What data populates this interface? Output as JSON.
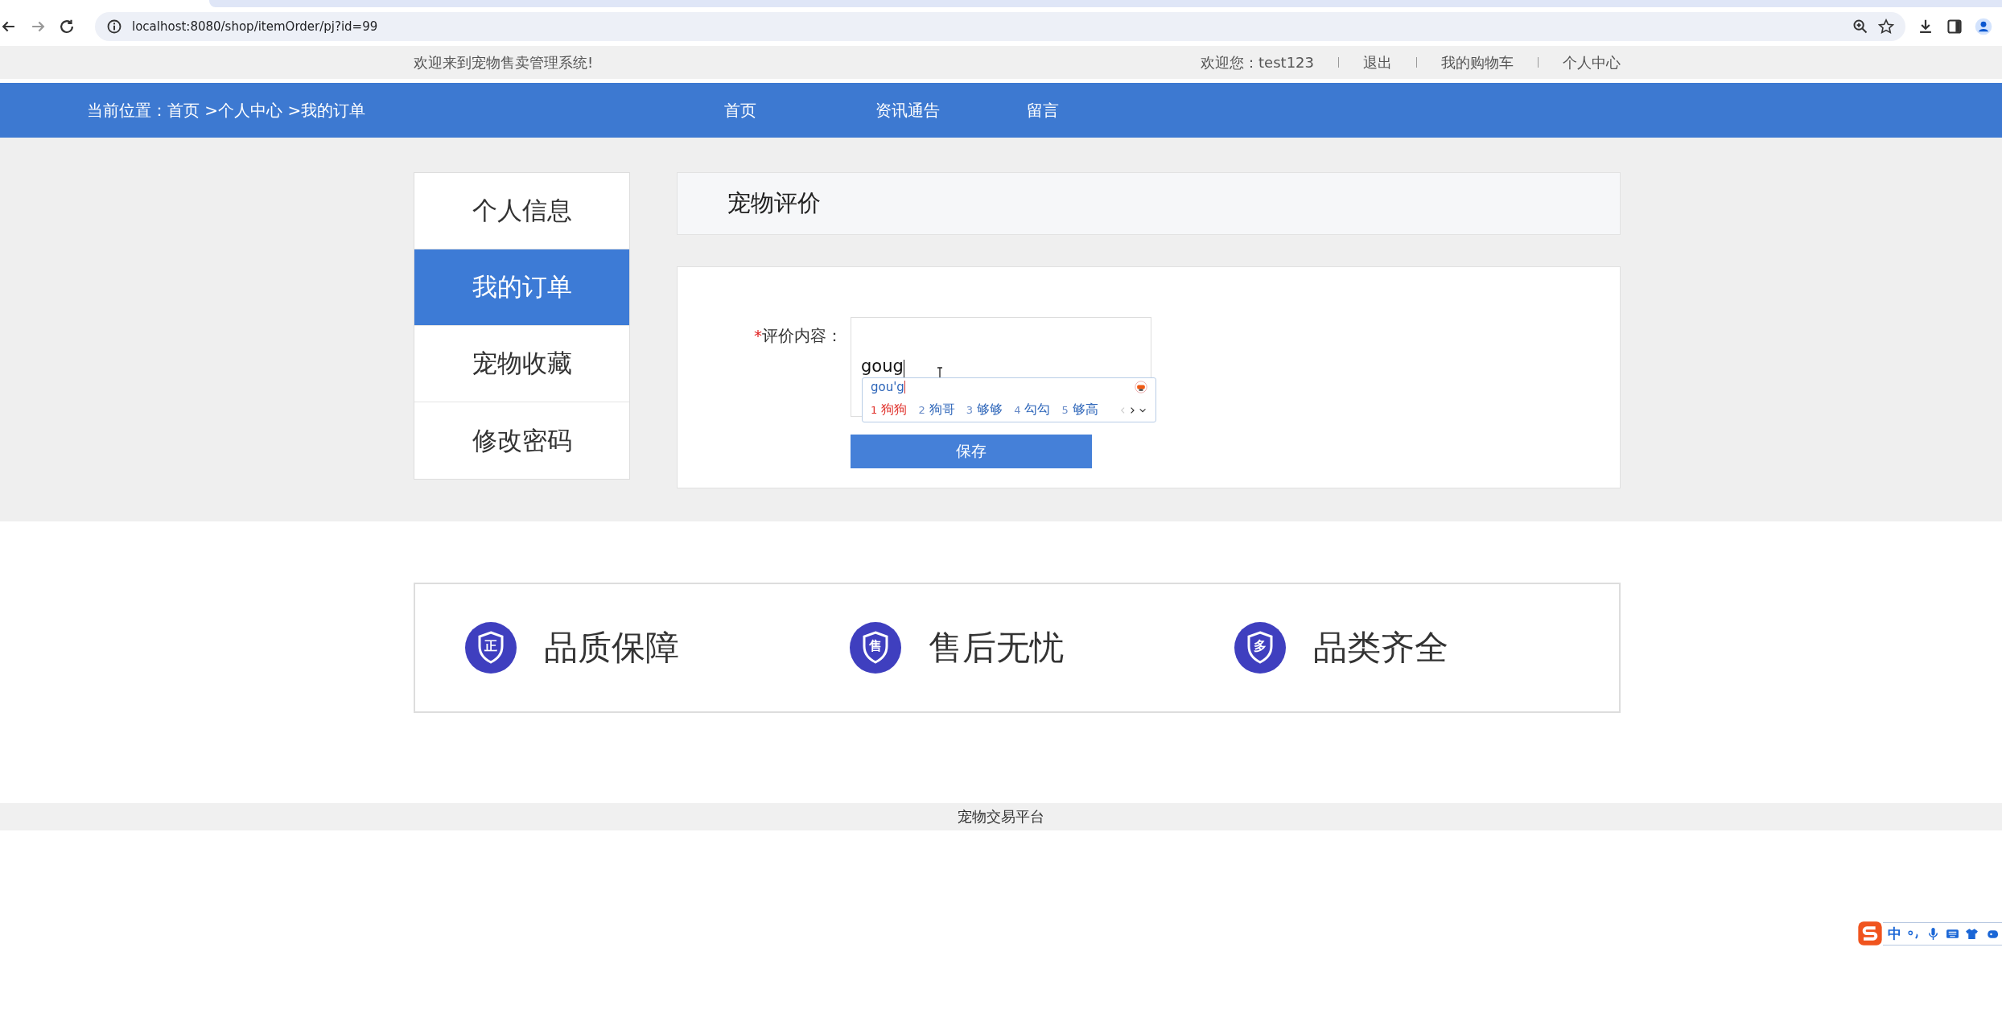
{
  "browser": {
    "url": "localhost:8080/shop/itemOrder/pj?id=99"
  },
  "top_bar": {
    "welcome": "欢迎来到宠物售卖管理系统!",
    "user": "欢迎您：test123",
    "links": [
      "退出",
      "我的购物车",
      "个人中心"
    ]
  },
  "nav": {
    "breadcrumb": "当前位置：首页 >个人中心 >我的订单",
    "items": [
      "首页",
      "资讯通告",
      "留言"
    ]
  },
  "sidebar": {
    "items": [
      {
        "label": "个人信息",
        "selected": false
      },
      {
        "label": "我的订单",
        "selected": true
      },
      {
        "label": "宠物收藏",
        "selected": false
      },
      {
        "label": "修改密码",
        "selected": false
      }
    ]
  },
  "panel": {
    "title": "宠物评价"
  },
  "form": {
    "required_mark": "*",
    "label": "评价内容：",
    "value": "goug",
    "button": "保存"
  },
  "ime_popup": {
    "composition": "gou'g",
    "candidates": [
      {
        "number": "1",
        "text": "狗狗",
        "selected": true
      },
      {
        "number": "2",
        "text": "狗哥",
        "selected": false
      },
      {
        "number": "3",
        "text": "够够",
        "selected": false
      },
      {
        "number": "4",
        "text": "勾勾",
        "selected": false
      },
      {
        "number": "5",
        "text": "够高",
        "selected": false
      }
    ]
  },
  "features": [
    {
      "badge": "正",
      "label": "品质保障"
    },
    {
      "badge": "售",
      "label": "售后无忧"
    },
    {
      "badge": "多",
      "label": "品类齐全"
    }
  ],
  "footer": "宠物交易平台",
  "ime_toolbar": {
    "mode": "中"
  }
}
